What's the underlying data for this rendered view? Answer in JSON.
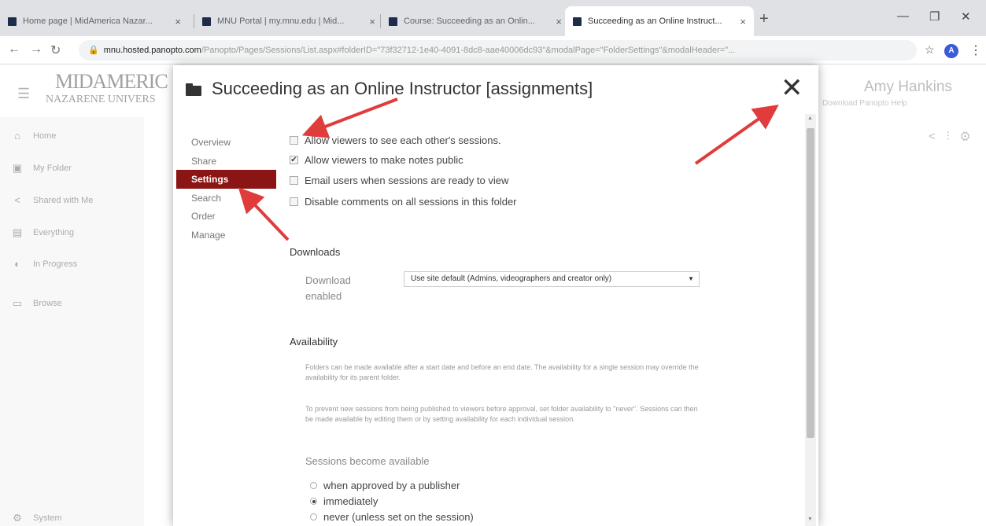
{
  "browser": {
    "tabs": [
      {
        "title": "Home page | MidAmerica Nazar..."
      },
      {
        "title": "MNU Portal | my.mnu.edu | Mid..."
      },
      {
        "title": "Course: Succeeding as an Onlin..."
      },
      {
        "title": "Succeeding as an Online Instruct..."
      }
    ],
    "url_host": "mnu.hosted.panopto.com",
    "url_path": "/Panopto/Pages/Sessions/List.aspx#folderID=\"73f32712-1e40-4091-8dc8-aae40006dc93\"&modalPage=\"FolderSettings\"&modalHeader=\"...",
    "profile_initial": "A"
  },
  "background_page": {
    "logo_line1": "MIDAMERIC",
    "logo_line2": "NAZARENE UNIVERS",
    "user_name": "Amy Hankins",
    "download_link": "Download Panopto  Help",
    "sidebar": [
      {
        "label": "Home"
      },
      {
        "label": "My Folder"
      },
      {
        "label": "Shared with Me"
      },
      {
        "label": "Everything"
      },
      {
        "label": "In Progress"
      },
      {
        "label": "Browse"
      },
      {
        "label": "System"
      }
    ]
  },
  "modal": {
    "title": "Succeeding as an Online Instructor [assignments]",
    "close_symbol": "✕",
    "nav": [
      {
        "label": "Overview"
      },
      {
        "label": "Share"
      },
      {
        "label": "Settings"
      },
      {
        "label": "Search"
      },
      {
        "label": "Order"
      },
      {
        "label": "Manage"
      }
    ],
    "checkboxes": [
      {
        "label": "Allow viewers to see each other's sessions.",
        "checked": false
      },
      {
        "label": "Allow viewers to make notes public",
        "checked": true
      },
      {
        "label": "Email users when sessions are ready to view",
        "checked": false
      },
      {
        "label": "Disable comments on all sessions in this folder",
        "checked": false
      }
    ],
    "downloads": {
      "heading": "Downloads",
      "label": "Download enabled",
      "selected": "Use site default (Admins, videographers and creator only)"
    },
    "availability": {
      "heading": "Availability",
      "para1": "Folders can be made available after a start date and before an end date. The availability for a single session may override the availability for its parent folder.",
      "para2": "To prevent new sessions from being published to viewers before approval, set folder availability to \"never\". Sessions can then be made available by editing them or by setting availability for each individual session.",
      "sessions_heading": "Sessions become available",
      "options": [
        {
          "label": "when approved by a publisher",
          "selected": false
        },
        {
          "label": "immediately",
          "selected": true
        },
        {
          "label": "never (unless set on the session)",
          "selected": false
        }
      ]
    }
  },
  "colors": {
    "active_nav": "#8b1414",
    "annotation_arrow": "#e03c3c"
  }
}
